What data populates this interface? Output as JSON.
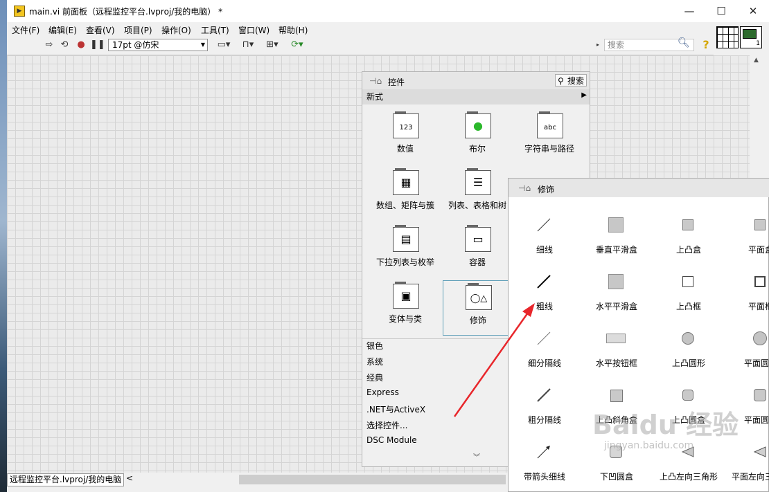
{
  "window": {
    "title": "main.vi 前面板（远程监控平台.lvproj/我的电脑） *",
    "app_icon": "labview-vi-icon",
    "controls": {
      "minimize": "—",
      "maximize": "☐",
      "close": "✕"
    }
  },
  "menubar": {
    "items": [
      "文件(F)",
      "编辑(E)",
      "查看(V)",
      "项目(P)",
      "操作(O)",
      "工具(T)",
      "窗口(W)",
      "帮助(H)"
    ]
  },
  "toolbar": {
    "font_value": "17pt @仿宋",
    "search_placeholder": "搜索",
    "buttons": [
      "run-arrow-icon",
      "run-continuously-icon",
      "abort-icon",
      "pause-icon",
      "align-icon",
      "distribute-icon",
      "resize-icon",
      "reorder-icon"
    ],
    "connector_number": "1"
  },
  "controls_palette": {
    "title": "控件",
    "search_label": "搜索",
    "category": "新式",
    "items": [
      {
        "label": "数值",
        "icon": "numeric-icon",
        "glyph": "123"
      },
      {
        "label": "布尔",
        "icon": "boolean-icon",
        "glyph": "●"
      },
      {
        "label": "字符串与路径",
        "icon": "string-path-icon",
        "glyph": "abc"
      },
      {
        "label": "数组、矩阵与簇",
        "icon": "array-icon",
        "glyph": "▦"
      },
      {
        "label": "列表、表格和树",
        "icon": "list-table-icon",
        "glyph": "☰"
      },
      {
        "label": "下拉列表与枚举",
        "icon": "ring-enum-icon",
        "glyph": "▤"
      },
      {
        "label": "容器",
        "icon": "container-icon",
        "glyph": "▭"
      },
      {
        "label": "变体与类",
        "icon": "variant-class-icon",
        "glyph": "▣"
      },
      {
        "label": "修饰",
        "icon": "decorations-icon",
        "glyph": "◯△"
      }
    ],
    "list": [
      "银色",
      "系统",
      "经典",
      "Express",
      ".NET与ActiveX",
      "选择控件...",
      "DSC Module"
    ],
    "more_icon": "︾"
  },
  "decorations_palette": {
    "title": "修饰",
    "items": [
      {
        "label": "细线",
        "shape": "line-thin"
      },
      {
        "label": "垂直平滑盒",
        "shape": "box-flat"
      },
      {
        "label": "上凸盒",
        "shape": "box-raised"
      },
      {
        "label": "平面盒",
        "shape": "box-flat"
      },
      {
        "label": "粗线",
        "shape": "line-thick"
      },
      {
        "label": "水平平滑盒",
        "shape": "box-flat"
      },
      {
        "label": "上凸框",
        "shape": "box-frame"
      },
      {
        "label": "平面框",
        "shape": "box-frame"
      },
      {
        "label": "细分隔线",
        "shape": "line-thin-light"
      },
      {
        "label": "水平按钮框",
        "shape": "button-box"
      },
      {
        "label": "上凸圆形",
        "shape": "circle"
      },
      {
        "label": "平面圆形",
        "shape": "circle"
      },
      {
        "label": "粗分隔线",
        "shape": "line-thick"
      },
      {
        "label": "上凸斜角盒",
        "shape": "box-flat"
      },
      {
        "label": "上凸圆盒",
        "shape": "rounded"
      },
      {
        "label": "平面圆盒",
        "shape": "rounded"
      },
      {
        "label": "带箭头细线",
        "shape": "arrow-line"
      },
      {
        "label": "下凹圆盒",
        "shape": "rounded"
      },
      {
        "label": "上凸左向三角形",
        "shape": "triangle-left"
      },
      {
        "label": "平面左向三角形",
        "shape": "triangle-left"
      }
    ]
  },
  "statusbar": {
    "path": "远程监控平台.lvproj/我的电脑",
    "scroll_left": "<"
  },
  "watermark": {
    "main": "Baidu 经验",
    "sub": "jingyan.baidu.com"
  },
  "annotation": {
    "color": "#e8262b"
  }
}
